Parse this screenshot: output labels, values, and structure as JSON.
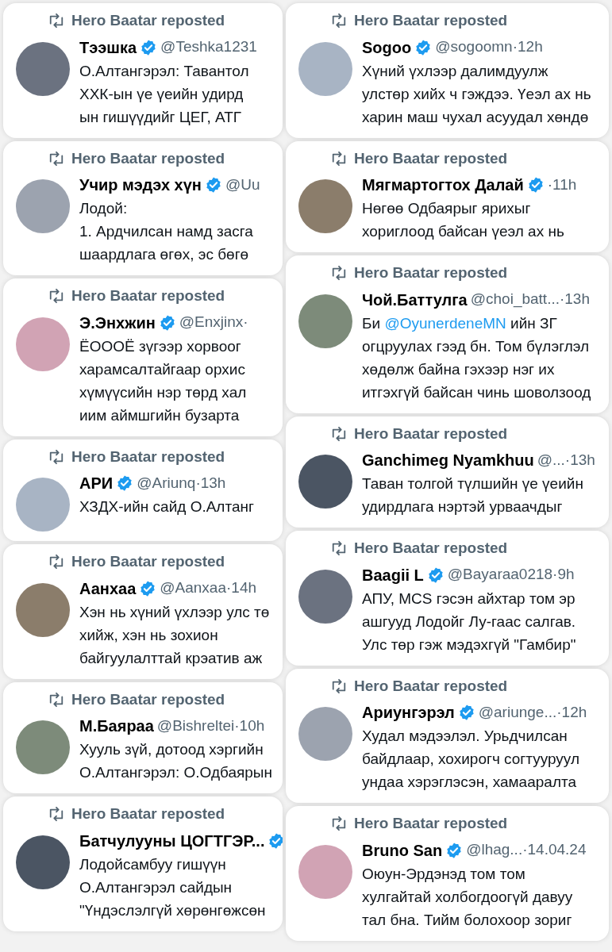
{
  "columns": [
    {
      "cards": [
        {
          "repost": "Hero Baatar reposted",
          "name": "Тээшка",
          "verified": true,
          "meta": "@Teshka1231",
          "lines": [
            "О.Алтангэрэл: Тавантол",
            "ХХК-ын үе үеийн удирд",
            "ын  гишүүдийг ЦЕГ, АТГ"
          ]
        },
        {
          "repost": "Hero Baatar reposted",
          "name": "Учир мэдэх хүн",
          "verified": true,
          "meta": "@Uu",
          "lines": [
            "Лодой:",
            "1. Ардчилсан намд засга",
            "шаардлага өгөх, эс бөгө"
          ]
        },
        {
          "repost": "Hero Baatar reposted",
          "name": "Э.Энхжин",
          "verified": true,
          "meta": "@Enxjinx·",
          "lines": [
            "ЁОООЁ зүгээр хорвоог",
            "харамсалтайгаар орхис",
            "хүмүүсийн нэр төрд хал",
            "иим аймшгийн бузарта"
          ]
        },
        {
          "repost": "Hero Baatar reposted",
          "name": "АРИ",
          "verified": true,
          "meta": "@Ariunq·13h",
          "lines": [
            "ХЗДХ-ийн сайд О.Алтанг"
          ]
        },
        {
          "repost": "Hero Baatar reposted",
          "name": "Аанхаа",
          "verified": true,
          "meta": "@Aanxaa·14h",
          "lines": [
            "Хэн нь хүний үхлээр улс тө",
            "хийж, хэн нь зохион",
            "байгуулалттай крэатив аж"
          ]
        },
        {
          "repost": "Hero Baatar reposted",
          "name": "М.Баяраа",
          "verified": false,
          "meta": "@Bishreltei·10h",
          "lines": [
            "Хууль зүй, дотоод хэргийн",
            "О.Алтангэрэл: О.Одбаярын"
          ]
        },
        {
          "repost": "Hero Baatar reposted",
          "name": "Батчулууны ЦОГТГЭР...",
          "verified": true,
          "lines": [
            "Лодойсамбуу гишүүн",
            "О.Алтангэрэл сайдын",
            "\"Үндэслэлгүй хөрөнгөжсөн"
          ]
        }
      ]
    },
    {
      "cards": [
        {
          "repost": "Hero Baatar reposted",
          "name": "Sogoo",
          "verified": true,
          "meta": "@sogoomn·12h",
          "lines": [
            "Хүний үхлээр далимдуулж",
            "улстөр хийх ч гэждээ. Үеэл ах нь",
            "харин маш чухал асуудал хөндө"
          ]
        },
        {
          "repost": "Hero Baatar reposted",
          "name": "Мягмартогтох Далай",
          "verified": true,
          "meta": "·11h",
          "lines": [
            "Нөгөө  Одбаярыг ярихыг",
            "хориглоод байсан үеэл ах нь"
          ]
        },
        {
          "repost": "Hero Baatar reposted",
          "name": "Чой.Баттулга",
          "verified": false,
          "meta": "@choi_batt...·13h",
          "lines": [
            "Би **@OyunerdeneMN** ийн ЗГ",
            "огцруулах гээд бн. Том  бүлэглэл",
            "хөдөлж байна гэхээр нэг их",
            "итгэхгүй байсан чинь шоволзоод"
          ]
        },
        {
          "repost": "Hero Baatar reposted",
          "name": "Ganchimeg Nyamkhuu",
          "verified": false,
          "meta": "@...·13h",
          "lines": [
            "Таван толгой түлшийн үе үеийн",
            "удирдлага нэртэй урваачдыг"
          ]
        },
        {
          "repost": "Hero Baatar reposted",
          "name": "Baagii L",
          "verified": true,
          "meta": "@Bayaraa0218·9h",
          "lines": [
            "АПУ, MCS гэсэн айхтар том эр",
            "ашгууд Лодойг Лу-гаас салгав.",
            "Улс төр гэж мэдэхгүй \"Гамбир\""
          ]
        },
        {
          "repost": "Hero Baatar reposted",
          "name": "Ариунгэрэл",
          "verified": true,
          "meta": "@ariunge...·12h",
          "lines": [
            "Худал мэдээлэл. Урьдчилсан",
            "байдлаар, хохирогч согтууруул",
            "ундаа хэрэглэсэн, хамааралта"
          ]
        },
        {
          "repost": "Hero Baatar reposted",
          "name": "Bruno San",
          "verified": true,
          "meta": "@lhag...·14.04.24",
          "lines": [
            "Оюун-Эрдэнэд том том",
            "хулгайтай холбогдоогүй давуу",
            "тал бна. Тийм болохоор зориг"
          ]
        }
      ]
    }
  ]
}
